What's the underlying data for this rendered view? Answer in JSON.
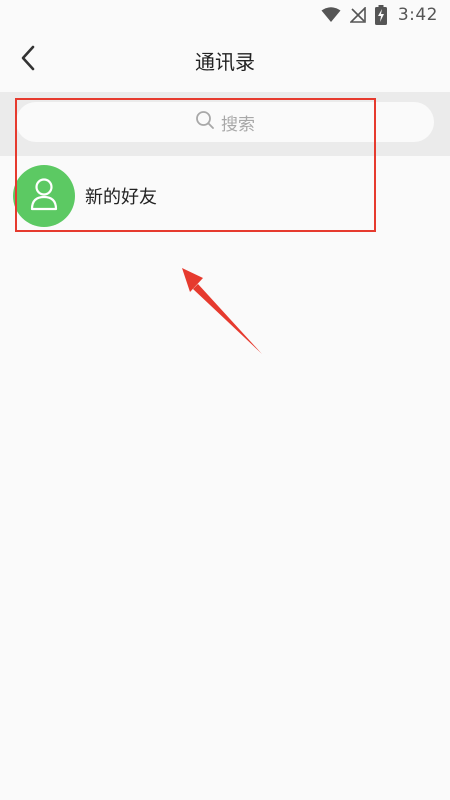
{
  "status_bar": {
    "time": "3:42",
    "icons": [
      "wifi-icon",
      "no-signal-icon",
      "battery-charging-icon"
    ]
  },
  "header": {
    "title": "通讯录",
    "back_icon": "chevron-left-icon"
  },
  "search": {
    "placeholder": "搜索",
    "icon": "search-icon"
  },
  "list": {
    "items": [
      {
        "label": "新的好友",
        "icon": "user-icon",
        "avatar_color": "#5cc963"
      }
    ]
  },
  "annotation": {
    "color": "#e63a2e"
  }
}
